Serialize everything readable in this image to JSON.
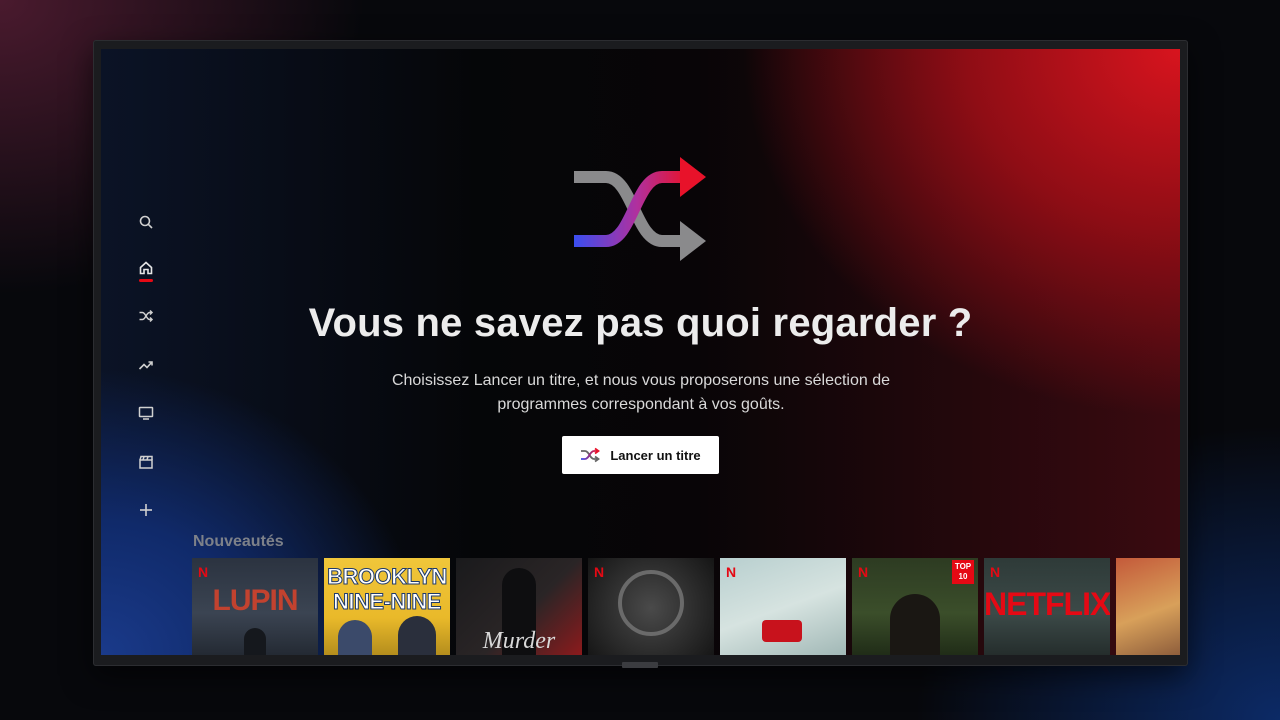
{
  "nav": {
    "items": [
      {
        "id": "search",
        "icon": "search-icon"
      },
      {
        "id": "home",
        "icon": "home-icon",
        "active": true
      },
      {
        "id": "shuffle",
        "icon": "shuffle-icon"
      },
      {
        "id": "trending",
        "icon": "trending-icon"
      },
      {
        "id": "tv-shows",
        "icon": "tv-icon"
      },
      {
        "id": "movies",
        "icon": "clapperboard-icon"
      },
      {
        "id": "my-list",
        "icon": "plus-icon"
      }
    ],
    "active_indicator_color": "#e50914"
  },
  "hero": {
    "icon": "shuffle-icon",
    "headline": "Vous ne savez pas quoi regarder ?",
    "subtext_line1": "Choisissez Lancer un titre, et nous vous proposerons une sélection de",
    "subtext_line2": "programmes correspondant à vos goûts.",
    "button_label": "Lancer un titre"
  },
  "row": {
    "title": "Nouveautés",
    "tiles": [
      {
        "title": "LUPIN",
        "badge": "N"
      },
      {
        "title": "BROOKLYN NINE-NINE",
        "line1": "BROOKLYN",
        "line2": "NINE-NINE"
      },
      {
        "title": "Murder",
        "badge": ""
      },
      {
        "title": "",
        "badge": "N"
      },
      {
        "title": "",
        "badge": "N"
      },
      {
        "title": "",
        "badge": "N",
        "top10": "TOP 10"
      },
      {
        "title": "NETFLIX",
        "badge": "N"
      },
      {
        "title": ""
      }
    ]
  },
  "colors": {
    "accent": "#e50914",
    "button_bg": "#ffffff"
  }
}
